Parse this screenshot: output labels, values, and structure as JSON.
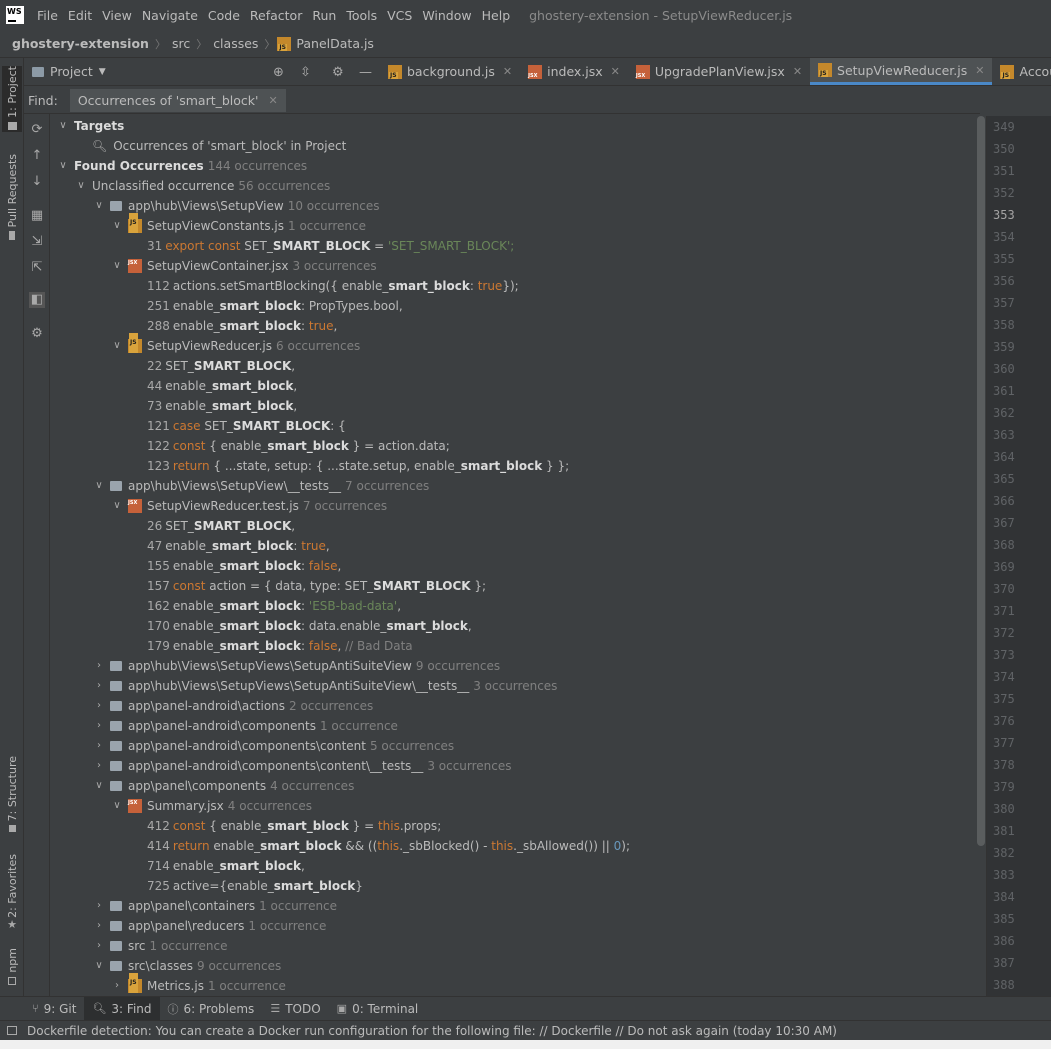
{
  "menu": {
    "items": [
      "File",
      "Edit",
      "View",
      "Navigate",
      "Code",
      "Refactor",
      "Run",
      "Tools",
      "VCS",
      "Window",
      "Help"
    ],
    "window_title": "ghostery-extension - SetupViewReducer.js"
  },
  "breadcrumb": {
    "project": "ghostery-extension",
    "dir1": "src",
    "dir2": "classes",
    "file": "PanelData.js"
  },
  "left_strip": {
    "project": "1: Project",
    "pull_requests": "Pull Requests",
    "structure": "7: Structure",
    "favorites": "2: Favorites",
    "npm": "npm"
  },
  "project_panel": {
    "title": "Project"
  },
  "editor_tabs": [
    {
      "label": "background.js",
      "type": "js"
    },
    {
      "label": "index.jsx",
      "type": "jsx"
    },
    {
      "label": "UpgradePlanView.jsx",
      "type": "jsx"
    },
    {
      "label": "SetupViewReducer.js",
      "type": "js"
    },
    {
      "label": "Account.js",
      "type": "js"
    }
  ],
  "find": {
    "label": "Find:",
    "tab": "Occurrences of 'smart_block'"
  },
  "tree": {
    "targets": "Targets",
    "target_item": "Occurrences of 'smart_block' in Project",
    "found": "Found Occurrences",
    "found_count": "144 occurrences",
    "unclassified": "Unclassified occurrence",
    "unclassified_count": "56 occurrences",
    "setupview": "app\\hub\\Views\\SetupView",
    "setupview_count": "10 occurrences",
    "constants_file": "SetupViewConstants.js",
    "constants_count": "1 occurrence",
    "c31_num": "31",
    "c31_kw": "export const",
    "c31_a": "SET_",
    "c31_b": "SMART_BLOCK",
    "c31_c": " = ",
    "c31_str": "'SET_SMART_BLOCK';",
    "container_file": "SetupViewContainer.jsx",
    "container_count": "3 occurrences",
    "k112_num": "112",
    "k112_a": "actions.setSmartBlocking({ enable_",
    "k112_b": "smart_block",
    "k112_c": ": ",
    "k112_kw": "true",
    "k112_d": " });",
    "k251_num": "251",
    "k251_a": "enable_",
    "k251_b": "smart_block",
    "k251_c": ": PropTypes.bool,",
    "k288_num": "288",
    "k288_a": "enable_",
    "k288_b": "smart_block",
    "k288_c": ": ",
    "k288_kw": "true",
    "k288_d": ",",
    "reducer_file": "SetupViewReducer.js",
    "reducer_count": "6 occurrences",
    "r22_num": "22",
    "r22_a": "SET_",
    "r22_b": "SMART_BLOCK",
    "r22_c": ",",
    "r44_num": "44",
    "r44_a": "enable_",
    "r44_b": "smart_block",
    "r44_c": ",",
    "r73_num": "73",
    "r73_a": "enable_",
    "r73_b": "smart_block",
    "r73_c": ",",
    "r121_num": "121",
    "r121_kw": "case",
    "r121_a": " SET_",
    "r121_b": "SMART_BLOCK",
    "r121_c": ": {",
    "r122_num": "122",
    "r122_kw": "const",
    "r122_a": " { enable_",
    "r122_b": "smart_block",
    "r122_c": " } = action.data;",
    "r123_num": "123",
    "r123_kw": "return",
    "r123_a": " { ...state, setup: { ...state.setup, enable_",
    "r123_b": "smart_block",
    "r123_c": " } };",
    "tests_dir": "app\\hub\\Views\\SetupView\\__tests__",
    "tests_dir_count": "7 occurrences",
    "test_file": "SetupViewReducer.test.js",
    "test_count": "7 occurrences",
    "t26_num": "26",
    "t26_a": "SET_",
    "t26_b": "SMART_BLOCK",
    "t26_c": ",",
    "t47_num": "47",
    "t47_a": "enable_",
    "t47_b": "smart_block",
    "t47_c": ": ",
    "t47_kw": "true",
    "t47_d": ",",
    "t155_num": "155",
    "t155_a": "enable_",
    "t155_b": "smart_block",
    "t155_c": ": ",
    "t155_kw": "false",
    "t155_d": ",",
    "t157_num": "157",
    "t157_kw": "const",
    "t157_a": " action = { data, type: SET_",
    "t157_b": "SMART_BLOCK",
    "t157_c": " };",
    "t162_num": "162",
    "t162_a": "enable_",
    "t162_b": "smart_block",
    "t162_c": ": ",
    "t162_str": "'ESB-bad-data'",
    "t162_d": ",",
    "t170_num": "170",
    "t170_a": "enable_",
    "t170_b": "smart_block",
    "t170_c": ": data.enable_",
    "t170_d": "smart_block",
    "t170_e": ",",
    "t179_num": "179",
    "t179_a": "enable_",
    "t179_b": "smart_block",
    "t179_c": ": ",
    "t179_kw": "false",
    "t179_d": ", ",
    "t179_cmt": "// Bad Data",
    "antisuite": "app\\hub\\Views\\SetupViews\\SetupAntiSuiteView",
    "antisuite_count": "9 occurrences",
    "antisuite_tests": "app\\hub\\Views\\SetupViews\\SetupAntiSuiteView\\__tests__",
    "antisuite_tests_count": "3 occurrences",
    "pa_actions": "app\\panel-android\\actions",
    "pa_actions_count": "2 occurrences",
    "pa_components": "app\\panel-android\\components",
    "pa_components_count": "1 occurrence",
    "pa_content": "app\\panel-android\\components\\content",
    "pa_content_count": "5 occurrences",
    "pa_content_tests": "app\\panel-android\\components\\content\\__tests__",
    "pa_content_tests_count": "3 occurrences",
    "panel_components": "app\\panel\\components",
    "panel_components_count": "4 occurrences",
    "summary_file": "Summary.jsx",
    "summary_count": "4 occurrences",
    "s412_num": "412",
    "s412_kw": "const",
    "s412_a": " { enable_",
    "s412_b": "smart_block",
    "s412_c": " } = ",
    "s412_kw2": "this",
    "s412_d": ".props;",
    "s414_num": "414",
    "s414_kw": "return",
    "s414_a": " enable_",
    "s414_b": "smart_block",
    "s414_c": " && ((",
    "s414_kw2": "this",
    "s414_d": "._sbBlocked() - ",
    "s414_kw3": "this",
    "s414_e": "._sbAllowed()) || ",
    "s414_num2": "0",
    "s414_f": ");",
    "s714_num": "714",
    "s714_a": "enable_",
    "s714_b": "smart_block",
    "s714_c": ",",
    "s725_num": "725",
    "s725_a": "active={enable_",
    "s725_b": "smart_block",
    "s725_c": "}",
    "panel_containers": "app\\panel\\containers",
    "panel_containers_count": "1 occurrence",
    "panel_reducers": "app\\panel\\reducers",
    "panel_reducers_count": "1 occurrence",
    "src": "src",
    "src_count": "1 occurrence",
    "src_classes": "src\\classes",
    "src_classes_count": "9 occurrences",
    "metrics_file": "Metrics.js",
    "metrics_count": "1 occurrence"
  },
  "gutter_lines": [
    "349",
    "350",
    "351",
    "352",
    "353",
    "354",
    "355",
    "356",
    "357",
    "358",
    "359",
    "360",
    "361",
    "362",
    "363",
    "364",
    "365",
    "366",
    "367",
    "368",
    "369",
    "370",
    "371",
    "372",
    "373",
    "374",
    "375",
    "376",
    "377",
    "378",
    "379",
    "380",
    "381",
    "382",
    "383",
    "384",
    "385",
    "386",
    "387",
    "388"
  ],
  "current_line": "353",
  "bottom_tabs": {
    "git": "9: Git",
    "find": "3: Find",
    "problems": "6: Problems",
    "todo": "TODO",
    "terminal": "0: Terminal"
  },
  "status": "Dockerfile detection: You can create a Docker run configuration for the following file: // Dockerfile // Do not ask again (today 10:30 AM)"
}
